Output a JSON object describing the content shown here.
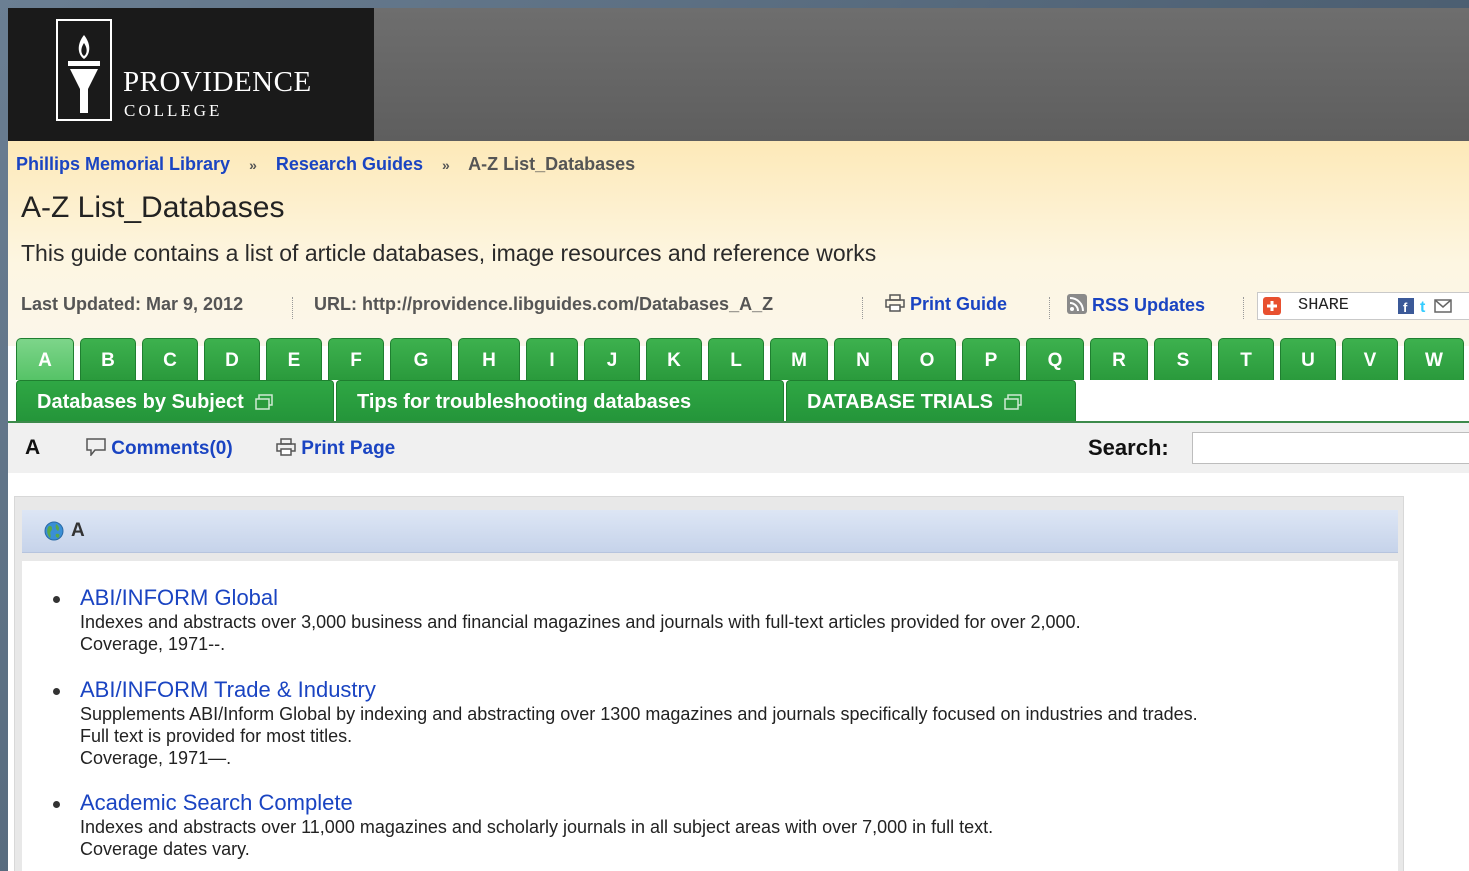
{
  "logo": {
    "line1": "PROVIDENCE",
    "line2": "COLLEGE"
  },
  "breadcrumb": {
    "home": "Phillips Memorial Library",
    "parent": "Research Guides",
    "current": "A-Z List_Databases",
    "separator": "»"
  },
  "guide": {
    "title": "A-Z List_Databases",
    "description": "This guide contains a list of article databases, image resources and reference works",
    "last_updated": "Last Updated: Mar 9, 2012",
    "url": "URL: http://providence.libguides.com/Databases_A_Z",
    "print_guide": "Print Guide",
    "rss": "RSS Updates",
    "share": "SHARE"
  },
  "letter_tabs": [
    "A",
    "B",
    "C",
    "D",
    "E",
    "F",
    "G",
    "H",
    "I",
    "J",
    "K",
    "L",
    "M",
    "N",
    "O",
    "P",
    "Q",
    "R",
    "S",
    "T",
    "U",
    "V",
    "W"
  ],
  "page_tabs": [
    "Databases by Subject",
    "Tips for troubleshooting databases",
    "DATABASE TRIALS"
  ],
  "toolbar": {
    "current_letter": "A",
    "comments": "Comments(0)",
    "print_page": "Print Page",
    "search_label": "Search:",
    "search_value": ""
  },
  "box": {
    "heading": "A",
    "entries": [
      {
        "title": "ABI/INFORM Global",
        "lines": [
          "Indexes and abstracts over 3,000 business and financial magazines and journals with full-text articles provided for over 2,000.",
          "Coverage, 1971--."
        ]
      },
      {
        "title": "ABI/INFORM Trade & Industry",
        "lines": [
          "Supplements ABI/Inform Global by indexing and abstracting over 1300 magazines and journals specifically focused on industries and trades.",
          "Full text is provided for most titles.",
          "Coverage, 1971—."
        ]
      },
      {
        "title": "Academic Search Complete",
        "lines": [
          "Indexes and abstracts over 11,000 magazines and scholarly journals in all subject areas with over 7,000 in full text.",
          "Coverage dates vary."
        ]
      }
    ]
  },
  "colors": {
    "link": "#1a44c2",
    "tab_green": "#2a9a3c",
    "active_tab": "#7dd58a",
    "banner": "#646464",
    "header_bg": "#fde9b8"
  }
}
